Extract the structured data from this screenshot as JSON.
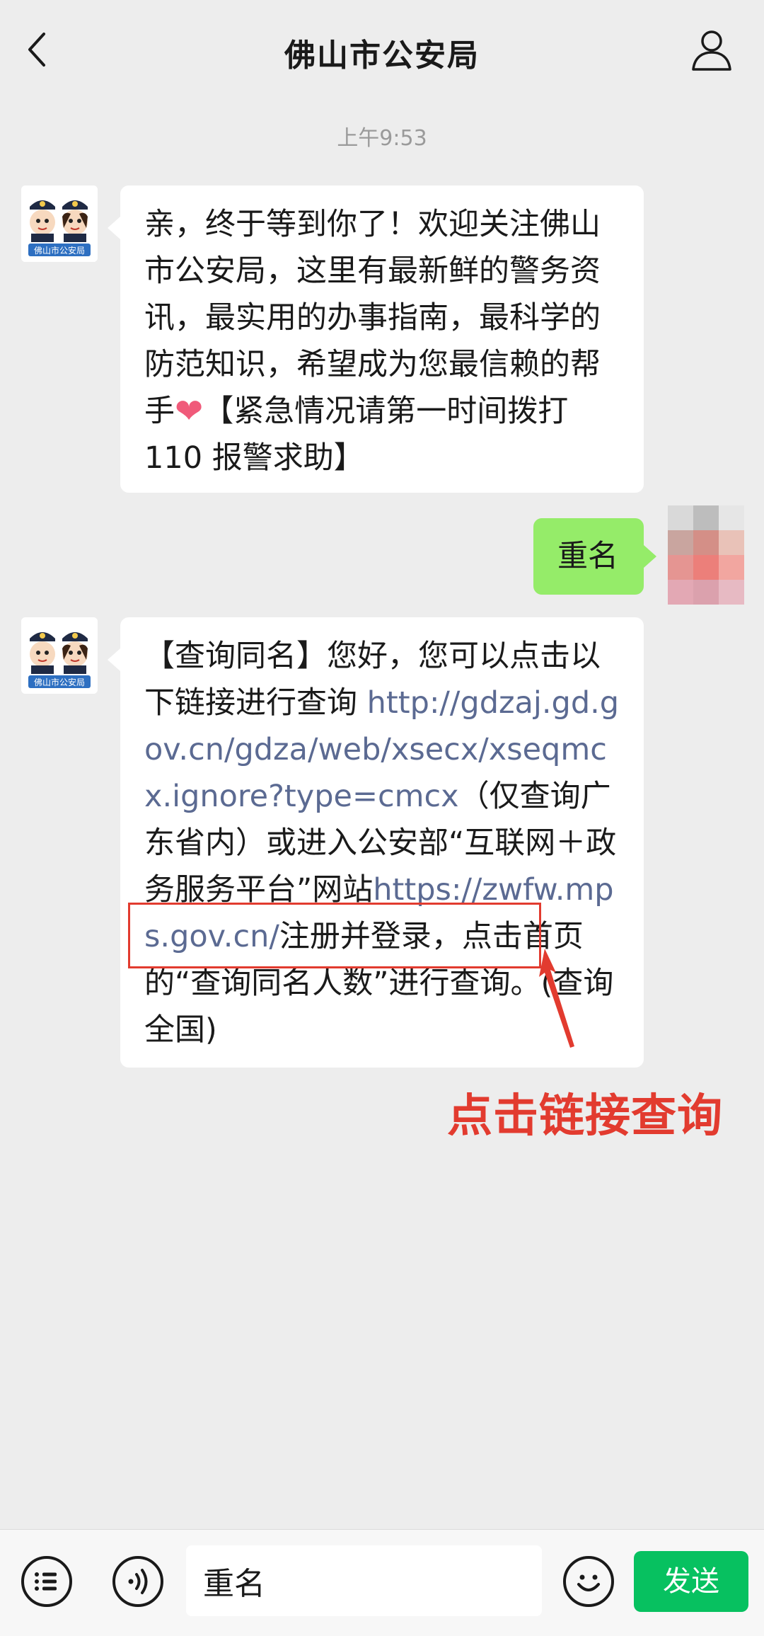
{
  "header": {
    "title": "佛山市公安局",
    "back_icon": "chevron-left-icon",
    "profile_icon": "person-icon"
  },
  "chat": {
    "timestamp": "上午9:53",
    "messages": [
      {
        "sender": "official",
        "avatar_label": "佛山市公安局",
        "text_before_heart": "亲，终于等到你了！欢迎关注佛山市公安局，这里有最新鲜的警务资讯，最实用的办事指南，最科学的防范知识，希望成为您最信赖的帮手",
        "heart": "❤",
        "text_after_heart": "【紧急情况请第一时间拨打110 报警求助】"
      },
      {
        "sender": "user",
        "text": "重名"
      },
      {
        "sender": "official",
        "avatar_label": "佛山市公安局",
        "part1": "【查询同名】您好，您可以点击以下链接进行查询 ",
        "link1": "http://gdzaj.gd.gov.cn/gdza/web/xsecx/xseqmcx.ignore?type=cmcx",
        "part2": "（仅查询广东省内）或进入公安部“互联网＋政务服务平台”网站",
        "link2": "https://zwfw.mps.gov.cn/",
        "part3": "注册并登录，点击首页的“查询同名人数”进行查询。(查询全国)"
      }
    ],
    "annotation": "点击链接查询"
  },
  "input_bar": {
    "menu_icon": "menu-list-icon",
    "voice_icon": "voice-icon",
    "value": "重名",
    "emoji_icon": "smile-emoji-icon",
    "send_label": "发送"
  },
  "colors": {
    "background": "#ededed",
    "bubble_user": "#95ec69",
    "link": "#5b6a92",
    "annotation": "#e23b2f",
    "send_button": "#07c160"
  }
}
